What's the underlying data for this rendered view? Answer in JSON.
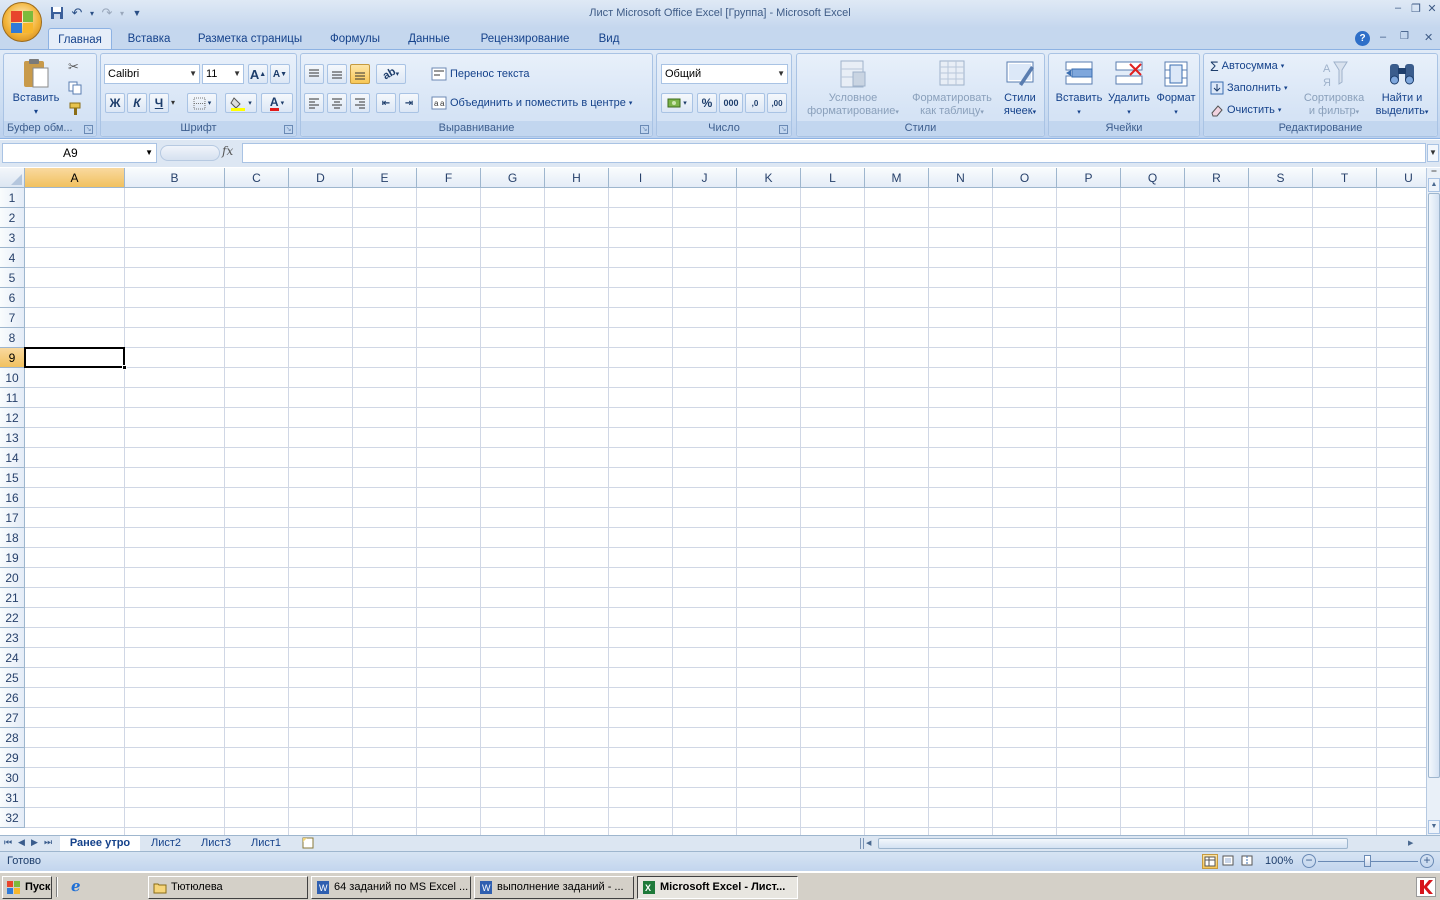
{
  "window": {
    "title": "Лист Microsoft Office Excel  [Группа] - Microsoft Excel",
    "controls": {
      "minimize": "–",
      "restore": "❐",
      "close": "✕"
    }
  },
  "ribbon_tabs": [
    "Главная",
    "Вставка",
    "Разметка страницы",
    "Формулы",
    "Данные",
    "Рецензирование",
    "Вид"
  ],
  "active_tab": "Главная",
  "ribbon": {
    "clipboard": {
      "label": "Буфер обм...",
      "paste": "Вставить"
    },
    "font": {
      "label": "Шрифт",
      "font_name": "Calibri",
      "font_size": "11",
      "bold": "Ж",
      "italic": "К",
      "underline": "Ч",
      "grow": "A",
      "shrink": "A",
      "color_letter": "A"
    },
    "alignment": {
      "label": "Выравнивание",
      "wrap": "Перенос текста",
      "merge": "Объединить и поместить в центре"
    },
    "number": {
      "label": "Число",
      "format": "Общий",
      "percent": "%",
      "thousands": "000",
      "inc": ",0",
      "dec": ",00"
    },
    "styles": {
      "label": "Стили",
      "conditional": [
        "Условное",
        "форматирование"
      ],
      "as_table": [
        "Форматировать",
        "как таблицу"
      ],
      "cell_styles": [
        "Стили",
        "ячеек"
      ]
    },
    "cells": {
      "label": "Ячейки",
      "insert": "Вставить",
      "delete": "Удалить",
      "format": "Формат"
    },
    "editing": {
      "label": "Редактирование",
      "autosum": "Автосумма",
      "fill": "Заполнить",
      "clear": "Очистить",
      "sort": [
        "Сортировка",
        "и фильтр"
      ],
      "find": [
        "Найти и",
        "выделить"
      ]
    }
  },
  "formula_bar": {
    "name_box": "A9",
    "fx": "fx",
    "value": ""
  },
  "columns": [
    "A",
    "B",
    "C",
    "D",
    "E",
    "F",
    "G",
    "H",
    "I",
    "J",
    "K",
    "L",
    "M",
    "N",
    "O",
    "P",
    "Q",
    "R",
    "S",
    "T",
    "U"
  ],
  "rows": [
    "1",
    "2",
    "3",
    "4",
    "5",
    "6",
    "7",
    "8",
    "9",
    "10",
    "11",
    "12",
    "13",
    "14",
    "15",
    "16",
    "17",
    "18",
    "19",
    "20",
    "21",
    "22",
    "23",
    "24",
    "25",
    "26",
    "27",
    "28",
    "29",
    "30",
    "31",
    "32"
  ],
  "selected_cell": {
    "column": "A",
    "row": "9"
  },
  "sheets": [
    "Ранее утро",
    "Лист2",
    "Лист3",
    "Лист1"
  ],
  "active_sheet": "Ранее утро",
  "status": {
    "mode": "Готово",
    "zoom": "100%"
  },
  "taskbar": {
    "start": "Пуск",
    "items": [
      "Тютюлева",
      "64 заданий по MS Excel ...",
      "выполнение заданий - ...",
      "Microsoft Excel - Лист..."
    ],
    "active_item": "Microsoft Excel - Лист..."
  }
}
